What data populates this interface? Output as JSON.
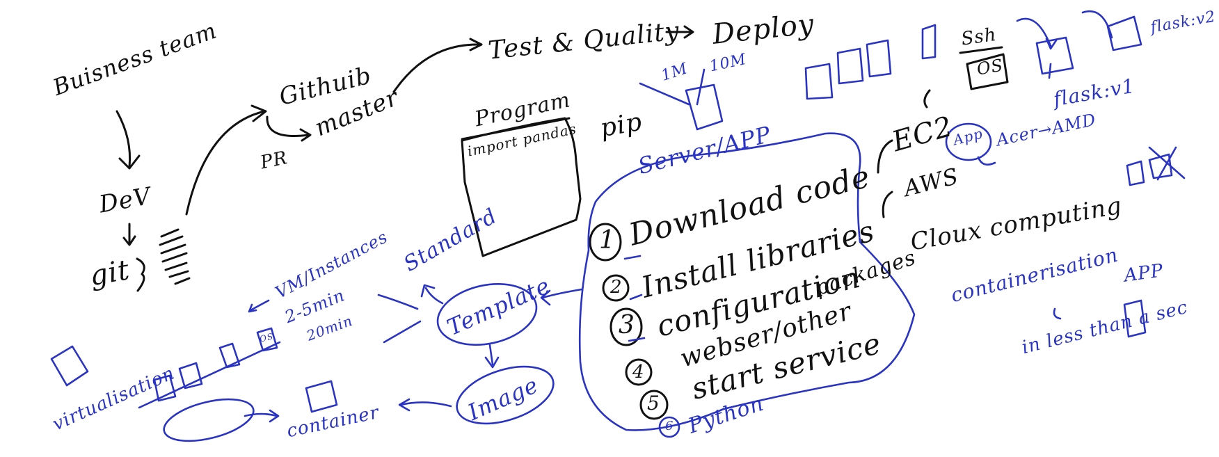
{
  "colors": {
    "ink_black": "#111111",
    "ink_blue": "#2a34c4",
    "background": "#ffffff"
  },
  "black_notes": {
    "business_team": "Buisness team",
    "dev": "DeV",
    "git": "git",
    "github": "Githuib",
    "master": "master",
    "pr": "PR",
    "test_quality": "Test & Quality",
    "deploy": "Deploy",
    "program_title": "Program",
    "program_line": "import pandas",
    "pip": "pip",
    "ec2": "EC2",
    "aws": "AWS",
    "cloud_computing": "Cloux computing",
    "ssh": "Ssh",
    "os": "OS",
    "steps": [
      {
        "num": "1",
        "text": "Download code"
      },
      {
        "num": "2",
        "text": "Install libraries"
      },
      {
        "num": "3",
        "text": "configuration"
      },
      {
        "num": "",
        "text": "webser/other"
      },
      {
        "num": "",
        "text": "packages"
      },
      {
        "num": "4",
        "text": "start service"
      },
      {
        "num": "5",
        "text": ""
      }
    ]
  },
  "blue_notes": {
    "im": "1M",
    "ten_m": "10M",
    "server_app": "Server/APP",
    "flask_v1": "flask:v1",
    "flask_v2": "flask:v2",
    "app_bubble": "App",
    "acer_amd": "Acer→AMD",
    "containerisation": "containerisation",
    "app_right": "APP",
    "in_less_than_sec": "in less than a sec",
    "standard": "Standard",
    "vm_instances": "VM/Instances",
    "two_five_min": "2-5min",
    "two_zero_min": "20min",
    "virtualisation": "virtualisation",
    "container": "container",
    "template": "Template",
    "image": "Image",
    "python": "Python",
    "step_six": "6",
    "os_small": "OS"
  }
}
